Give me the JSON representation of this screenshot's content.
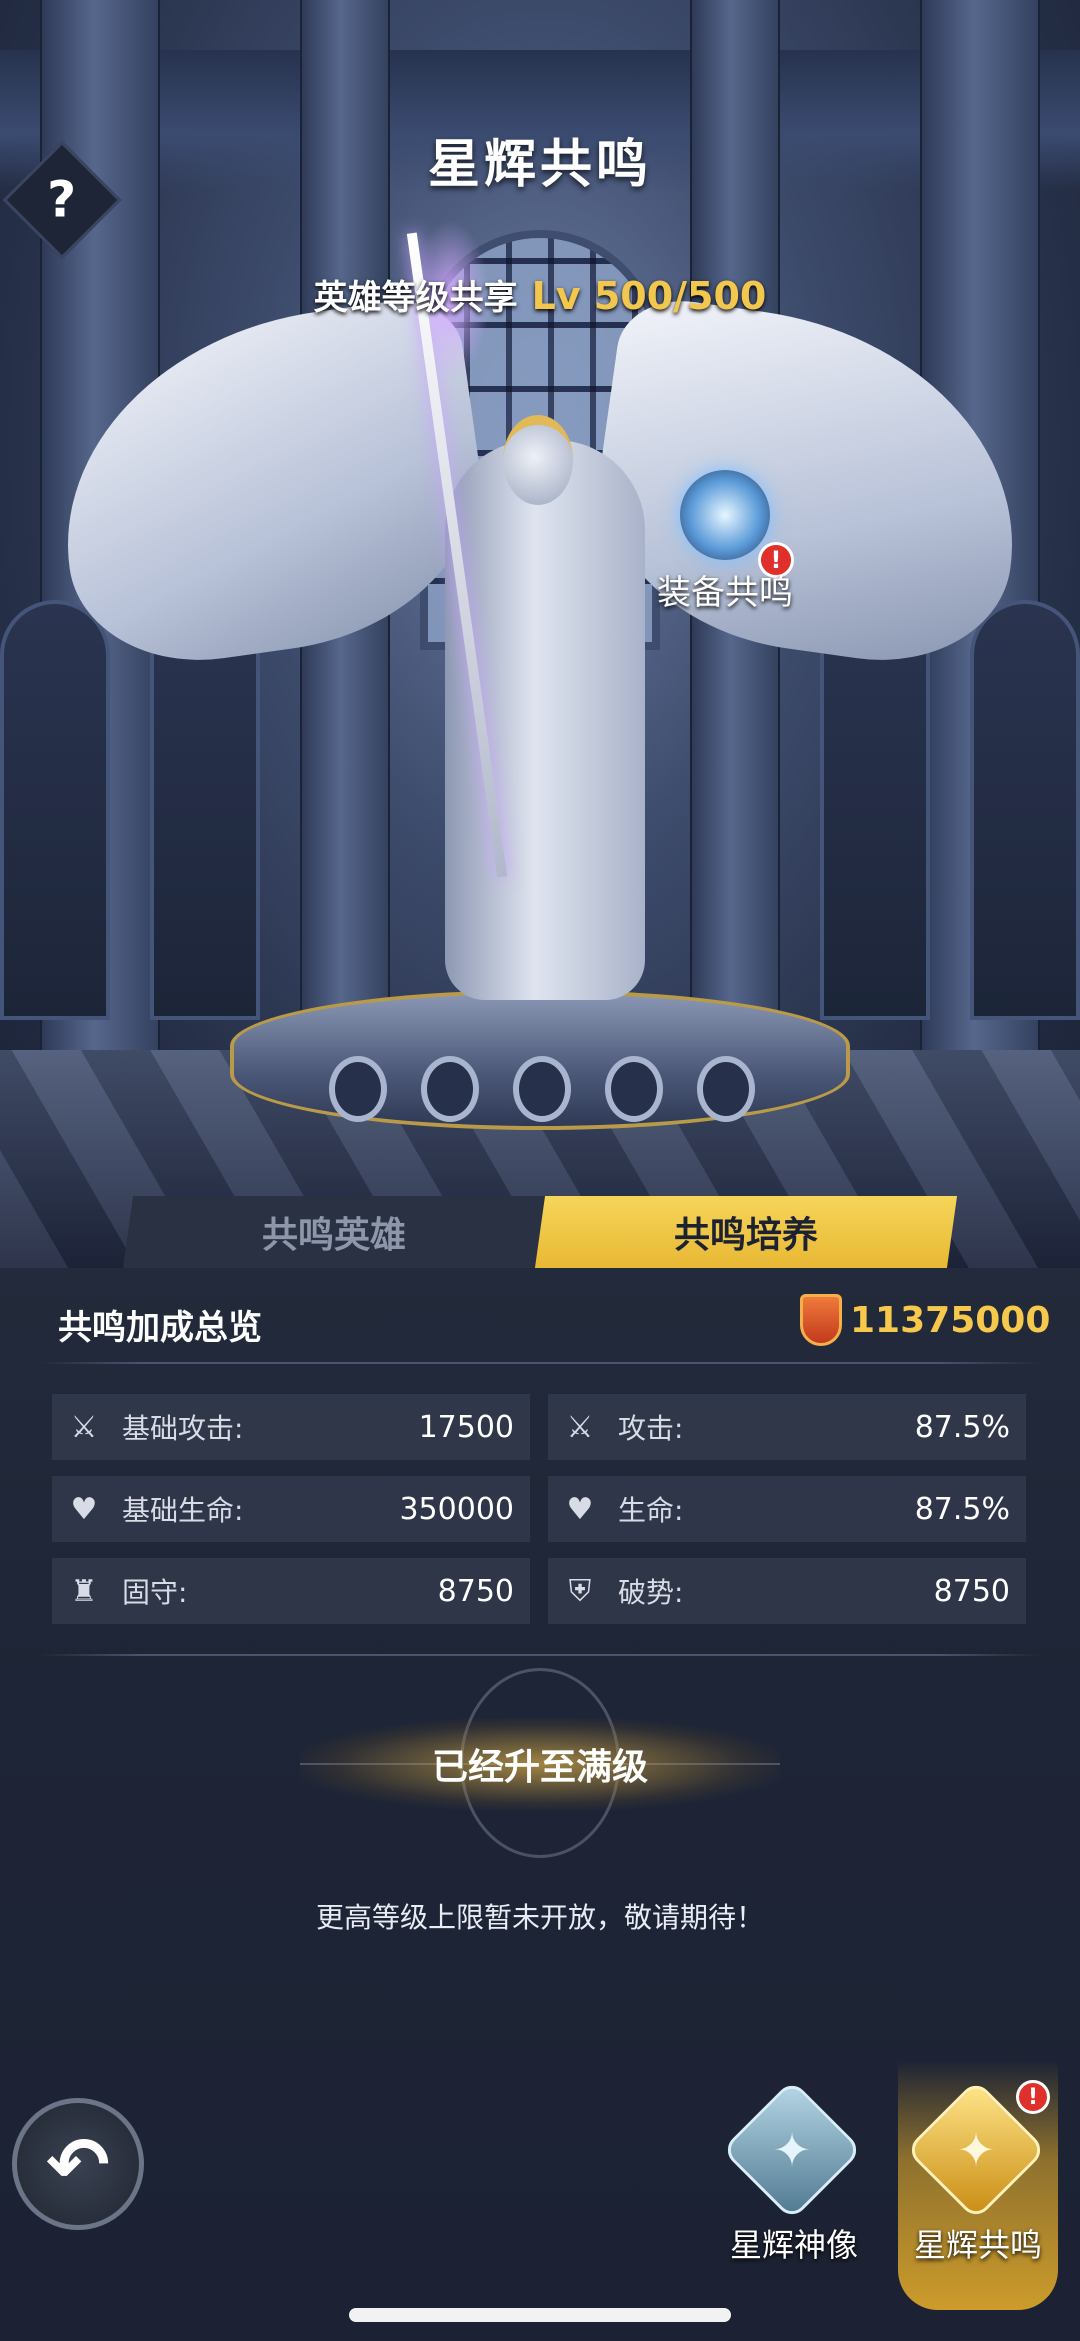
{
  "header": {
    "title": "星辉共鸣",
    "help_glyph": "?",
    "level_label": "英雄等级共享",
    "level_value": "Lv 500/500"
  },
  "equip_resonance": {
    "label": "装备共鸣",
    "alert": "!"
  },
  "tabs": [
    {
      "label": "共鸣英雄",
      "active": false
    },
    {
      "label": "共鸣培养",
      "active": true
    }
  ],
  "summary": {
    "title": "共鸣加成总览",
    "power_value": "11375000",
    "power_icon": "shield-icon"
  },
  "stats": [
    {
      "icon": "sword-icon",
      "name": "基础攻击:",
      "value": "17500"
    },
    {
      "icon": "sword-up-icon",
      "name": "攻击:",
      "value": "87.5%"
    },
    {
      "icon": "heart-icon",
      "name": "基础生命:",
      "value": "350000"
    },
    {
      "icon": "heart-up-icon",
      "name": "生命:",
      "value": "87.5%"
    },
    {
      "icon": "fortress-icon",
      "name": "固守:",
      "value": "8750"
    },
    {
      "icon": "broken-shield-icon",
      "name": "破势:",
      "value": "8750"
    }
  ],
  "status": {
    "maxed_label": "已经升至满级",
    "note": "更高等级上限暂未开放，敬请期待！"
  },
  "nav": {
    "back_glyph": "↶",
    "items": [
      {
        "label": "星辉神像",
        "icon": "statue-emblem-icon",
        "active": false
      },
      {
        "label": "星辉共鸣",
        "icon": "resonance-emblem-icon",
        "active": true,
        "alert": "!"
      }
    ]
  },
  "colors": {
    "accent_gold": "#f1c84d",
    "tab_active": "#f6d55a",
    "alert_red": "#e0302c",
    "panel_bg": "#1e2536"
  }
}
